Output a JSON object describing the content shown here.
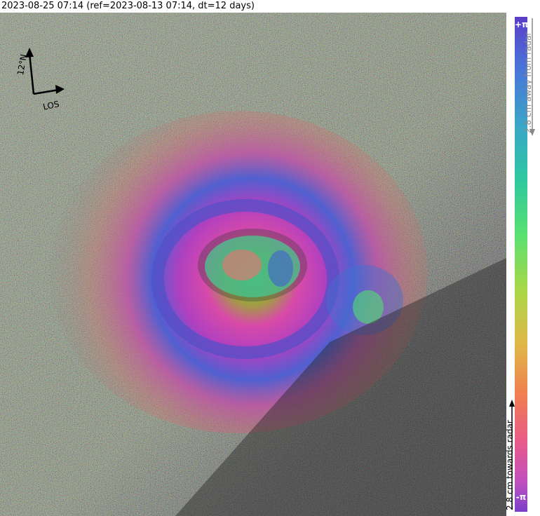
{
  "header": {
    "title": "2023-08-25 07:14 (ref=2023-08-13 07:14, dt=12 days)"
  },
  "orientation": {
    "north_label": "12°N",
    "los_label": "LOS"
  },
  "colorbar": {
    "top_label": "+π",
    "bottom_label": "-π",
    "away_text": "2.8 cm away from radar",
    "towards_text": "2.8 cm towards radar",
    "colors": [
      "#5a3ec8",
      "#4a72d8",
      "#3aa6c8",
      "#2ec8a0",
      "#58e070",
      "#a8d848",
      "#e0b848",
      "#f08050",
      "#e85a8a",
      "#c050c0",
      "#7a40c8"
    ]
  },
  "image": {
    "colors": {
      "background_terrain": "#3a3a3a",
      "ring_magenta": "#c040b0",
      "ring_blue": "#4860d0",
      "crater_green": "#40d870"
    }
  }
}
